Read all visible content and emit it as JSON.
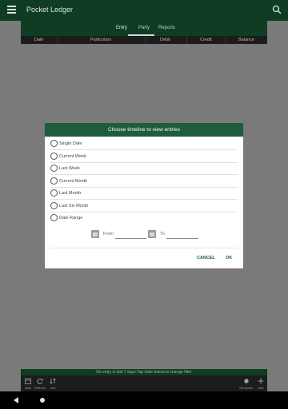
{
  "app": {
    "title": "Pocket Ledger"
  },
  "tabs": [
    "Entry",
    "Party",
    "Reports"
  ],
  "columns": [
    "Date",
    "Particulars",
    "Debit",
    "Credit",
    "Balance"
  ],
  "dialog": {
    "title": "Choose timeline to view entries",
    "options": [
      "Single Date",
      "Current Week",
      "Last Week",
      "Current Month",
      "Last Month",
      "Last Six Month",
      "Date Range"
    ],
    "from_label": "From",
    "to_label": "To",
    "cancel": "CANCEL",
    "ok": "OK"
  },
  "status_text": "No entry in last 7 days.Tap Date below to change filter",
  "toolbar": [
    "Date",
    "Refresh",
    "Sort",
    "Reminder",
    "Add"
  ],
  "colors": {
    "primary_dark": "#0f3d23",
    "dialog_header": "#1f5c3c",
    "accent": "#1f5c3c"
  }
}
